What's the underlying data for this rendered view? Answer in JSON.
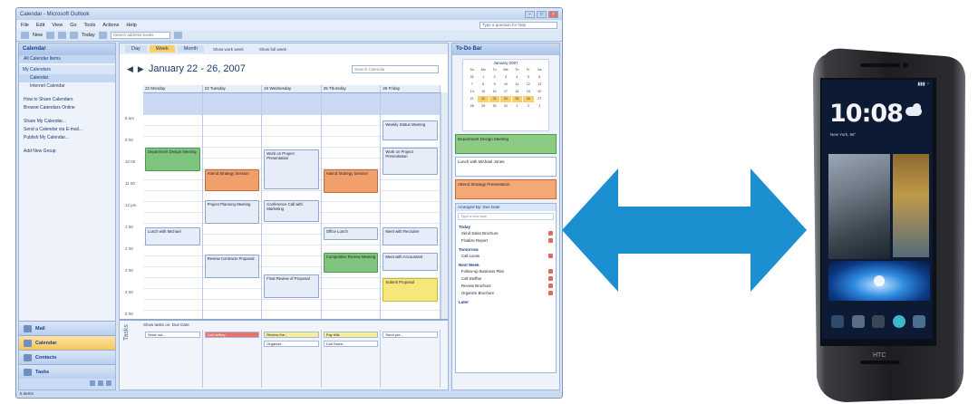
{
  "outlook": {
    "title": "Calendar - Microsoft Outlook",
    "menu": [
      "File",
      "Edit",
      "View",
      "Go",
      "Tools",
      "Actions",
      "Help"
    ],
    "help_placeholder": "Type a question for help",
    "toolbar_new": "New",
    "toolbar_today": "Today",
    "toolbar_search_placeholder": "Search address books",
    "nav": {
      "header": "Calendar",
      "all_items": "All Calendar Items",
      "my_calendars": "My Calendars",
      "calendar_item": "Calendar",
      "internet_calendar": "Internet Calendar",
      "links": [
        "How to Share Calendars",
        "Browse Calendars Online",
        "Share My Calendar...",
        "Send a Calendar via E-mail...",
        "Publish My Calendar...",
        "Add New Group"
      ],
      "buttons": [
        "Mail",
        "Calendar",
        "Contacts",
        "Tasks"
      ]
    },
    "view_tabs": [
      "Day",
      "Week",
      "Month"
    ],
    "view_options": [
      "Show work week",
      "Show full week"
    ],
    "date_range": "January 22 - 26, 2007",
    "search_placeholder": "Search Calendar",
    "days": [
      "22 Monday",
      "23 Tuesday",
      "24 Wednesday",
      "25 Thursday",
      "26 Friday"
    ],
    "times": [
      "8 am",
      "9 00",
      "10 00",
      "11 00",
      "12 pm",
      "1 00",
      "2 00",
      "3 00",
      "4 00",
      "5 00"
    ],
    "appointments": {
      "a1": "Weekly Status Meeting",
      "a2": "Department Design Meeting",
      "a3": "Work on Project Presentation",
      "a4": "Attend Strategy Session",
      "a5": "Project Planning Meeting",
      "a6": "Lunch with Michael",
      "a7": "Conference Call with Marketing",
      "a8": "Office Lunch",
      "a9": "Meet with Recruiter",
      "a10": "Review Contracts Proposal",
      "a11": "Competitive Review Meeting",
      "a12": "Meet with Accountant",
      "a13": "Final Review of Proposal",
      "a14": "Submit Proposal"
    },
    "tasks_label": "Tasks",
    "tasks_header": "Show tasks on: Due Date",
    "task_chips": [
      "Send out...",
      "Call Jeffrey",
      "Review the...",
      "Pay bills",
      "Organize...",
      "Call Grant...",
      "Send pre..."
    ],
    "todo": {
      "header": "To-Do Bar",
      "month": "January 2007",
      "weekdays": [
        "Su",
        "Mo",
        "Tu",
        "We",
        "Th",
        "Fr",
        "Sa"
      ],
      "dates": [
        "31",
        "1",
        "2",
        "3",
        "4",
        "5",
        "6",
        "7",
        "8",
        "9",
        "10",
        "11",
        "12",
        "13",
        "14",
        "15",
        "16",
        "17",
        "18",
        "19",
        "20",
        "21",
        "22",
        "23",
        "24",
        "25",
        "26",
        "27",
        "28",
        "29",
        "30",
        "31",
        "1",
        "2",
        "3"
      ],
      "appts": [
        "Department Design Meeting",
        "Lunch with Michael Jones",
        "Attend Strategy Presentation"
      ],
      "arranged_by": "Arranged By: Due Date",
      "new_task_placeholder": "Type a new task",
      "groups": [
        {
          "name": "Today",
          "items": [
            "Send Sales Brochure",
            "Finalize Report"
          ]
        },
        {
          "name": "Tomorrow",
          "items": [
            "Call Lucas"
          ]
        },
        {
          "name": "Next Week",
          "items": [
            "Follow-up Business Plan",
            "Call Steffan",
            "Review Brochure",
            "Organize Brochure"
          ]
        },
        {
          "name": "Later",
          "items": []
        }
      ]
    },
    "status": "5 Items"
  },
  "phone": {
    "clock": "10:08",
    "status": "HTC",
    "location": "New York, 68°"
  },
  "colors": {
    "arrow": "#1b8fd0",
    "accent_orange": "#f9cf6e",
    "appt_green": "#7fc47c",
    "appt_orange": "#f2a06b"
  }
}
